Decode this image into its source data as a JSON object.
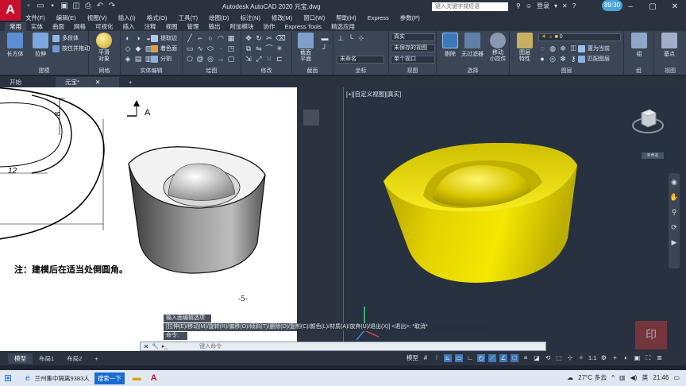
{
  "title": "Autodesk AutoCAD 2020    元宝.dwg",
  "search_placeholder": "键入关键字或短语",
  "user": "登录",
  "clock_badge": "89:30",
  "menu": [
    "文件(F)",
    "编辑(E)",
    "视图(V)",
    "插入(I)",
    "格式(O)",
    "工具(T)",
    "绘图(D)",
    "标注(N)",
    "修改(M)",
    "窗口(W)",
    "帮助(H)",
    "Express",
    "参数(P)"
  ],
  "ribbon_tabs": [
    "常用",
    "实体",
    "曲面",
    "网格",
    "可视化",
    "插入",
    "注释",
    "视图",
    "管理",
    "输出",
    "附加模块",
    "协作",
    "Express Tools",
    "精选应用"
  ],
  "ribbon": {
    "modeling": {
      "title": "建模",
      "box": "长方体",
      "extrude": "拉伸",
      "polysolid": "多段体",
      "presspull": "按住并拖动"
    },
    "mesh": {
      "title": "网格",
      "smooth": "平滑\n对象"
    },
    "solid_edit": {
      "title": "实体编辑",
      "extract": "提取边",
      "colorface": "着色面",
      "separate": "分割"
    },
    "draw": {
      "title": "绘图"
    },
    "modify": {
      "title": "修改"
    },
    "section": {
      "title": "截面",
      "plane": "截面\n平面"
    },
    "coords": {
      "title": "坐标",
      "ucs_name": "未命名"
    },
    "view": {
      "title": "视图",
      "style": "真实",
      "saved": "未保存的视图",
      "single": "单个视口"
    },
    "selection": {
      "title": "选择",
      "cull": "剔除",
      "nofilter": "无过滤器",
      "gizmo": "移动\n小控件"
    },
    "layers": {
      "title": "图层",
      "props": "图层\n特性",
      "layer_name": "0",
      "set_current": "置为当前",
      "match": "匹配图层"
    },
    "groups": {
      "title": "组",
      "group": "组"
    },
    "view_base": {
      "title": "视图",
      "base": "基点"
    }
  },
  "doc_tabs": [
    "开始",
    "元宝*"
  ],
  "viewport_label": "[+][自定义视图][真实]",
  "drawing": {
    "dim_vertical": "8",
    "dim_horizontal": "12",
    "section_mark": "A",
    "note": "注：建模后在适当处倒圆角。",
    "page": "-5-"
  },
  "command": {
    "history1": "输入面编辑选项",
    "history2": "[拉伸(E)/移动(M)/旋转(R)/偏移(O)/倾斜(T)/删除(D)/复制(C)/颜色(L)/材质(A)/放弃(U)/退出(X)] <退出>: *取消*",
    "history3": "命令:",
    "placeholder": "键入命令"
  },
  "layout_tabs": [
    "模型",
    "布局1",
    "布局2"
  ],
  "status": {
    "model": "模型",
    "scale": "1:1"
  },
  "taskbar": {
    "app1": "兰州集中隔离9383人",
    "search_btn": "搜索一下",
    "weather": "27°C  多云",
    "ime": "英",
    "time": "21:46"
  },
  "wcs": "未命名",
  "colors": {
    "accent": "#3d78b8",
    "ingot_gold": "#e3d200",
    "viewport_bg": "#273140",
    "ribbon_bg": "#3b4556"
  }
}
